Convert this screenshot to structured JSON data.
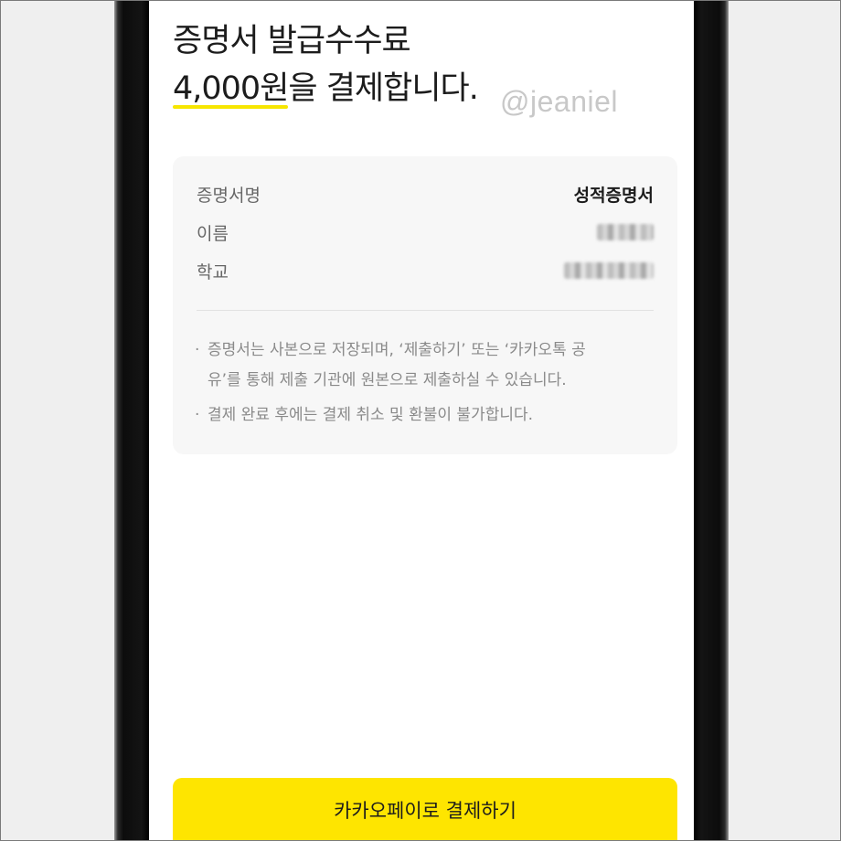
{
  "headline": {
    "line1": "증명서 발급수수료",
    "amount": "4,000원",
    "line2_rest": "을 결제합니다."
  },
  "watermark": "@jeaniel",
  "details": [
    {
      "label": "증명서명",
      "value": "성적증명서"
    },
    {
      "label": "이름",
      "value": null
    },
    {
      "label": "학교",
      "value": null
    }
  ],
  "notices": [
    {
      "line1": "증명서는 사본으로 저장되며, ‘제출하기’ 또는 ‘카카오톡 공",
      "line2": "유’를 통해 제출 기관에 원본으로 제출하실 수 있습니다."
    },
    {
      "line1": "결제 완료 후에는 결제 취소 및 환불이 불가합니다."
    }
  ],
  "pay_button_label": "카카오페이로 결제하기",
  "colors": {
    "accent": "#fee500",
    "underline": "#f7e600"
  }
}
